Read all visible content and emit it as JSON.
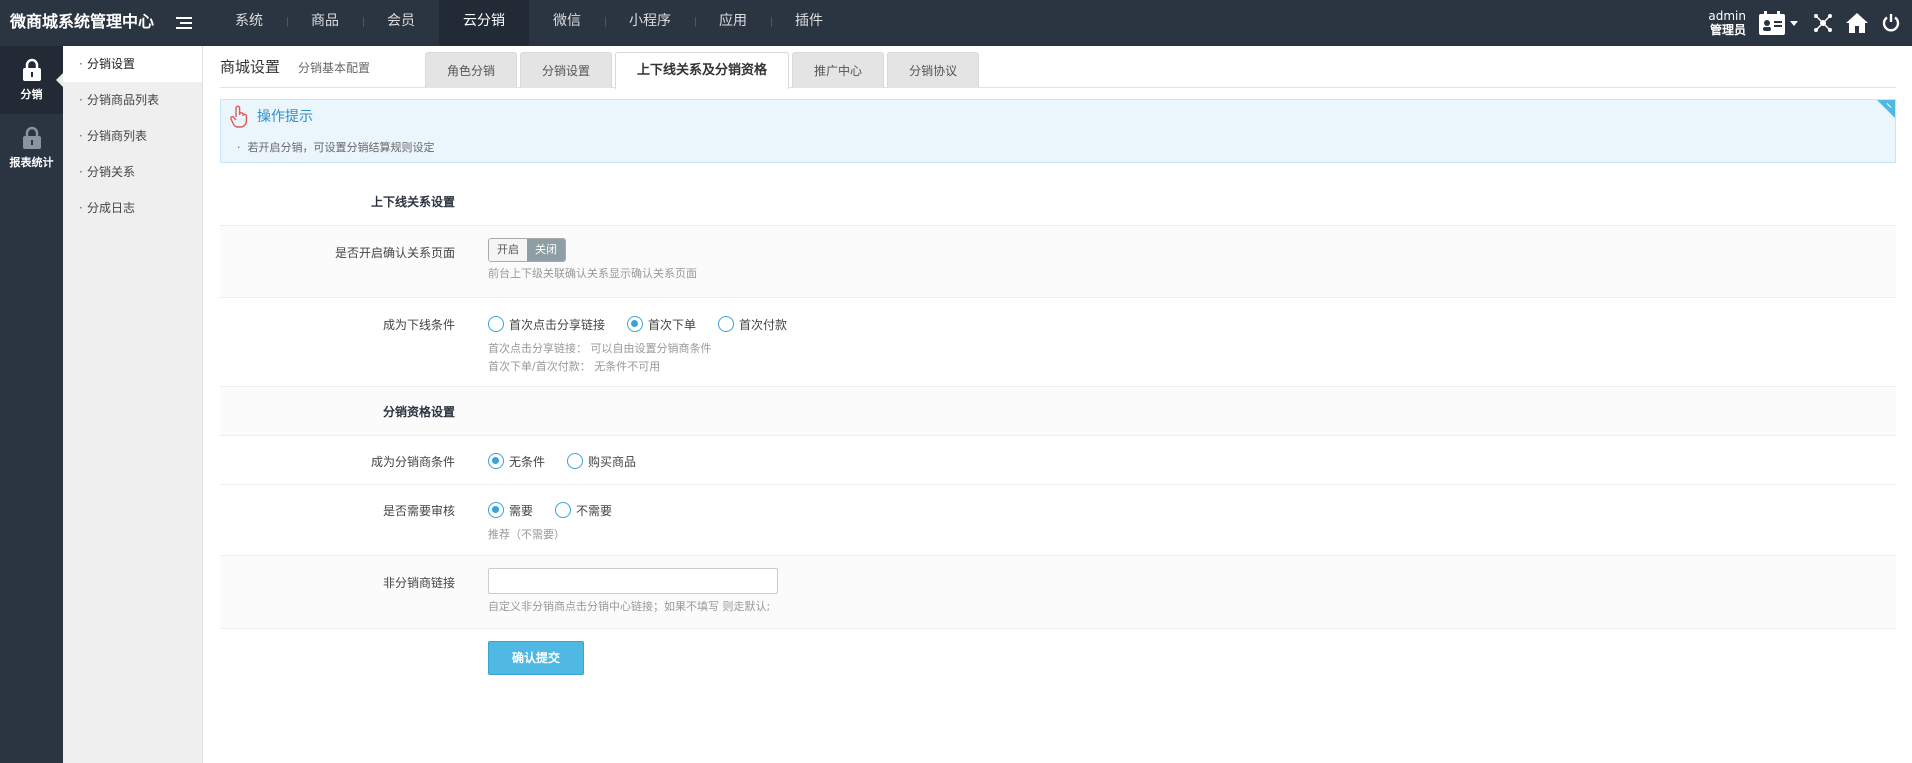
{
  "app": {
    "title": "微商城系统管理中心"
  },
  "nav": [
    "系统",
    "商品",
    "会员",
    "云分销",
    "微信",
    "小程序",
    "应用",
    "插件"
  ],
  "user": {
    "name": "admin",
    "role": "管理员"
  },
  "iconbar": [
    {
      "label": "分销",
      "icon": "lock-icon"
    },
    {
      "label": "报表统计",
      "icon": "lock-icon"
    }
  ],
  "submenu": [
    "分销设置",
    "分销商品列表",
    "分销商列表",
    "分销关系",
    "分成日志"
  ],
  "page": {
    "title": "商城设置",
    "subtitle": "分销基本配置"
  },
  "tabs": [
    "角色分销",
    "分销设置",
    "上下线关系及分销资格",
    "推广中心",
    "分销协议"
  ],
  "tip": {
    "title": "操作提示",
    "text": "若开启分销，可设置分销结算规则设定"
  },
  "form": {
    "section1": "上下线关系设置",
    "confirm_page": {
      "label": "是否开启确认关系页面",
      "on": "开启",
      "off": "关闭",
      "help": "前台上下级关联确认关系显示确认关系页面"
    },
    "downline": {
      "label": "成为下线条件",
      "options": [
        "首次点击分享链接",
        "首次下单",
        "首次付款"
      ],
      "help1": "首次点击分享链接： 可以自由设置分销商条件",
      "help2": "首次下单/首次付款： 无条件不可用"
    },
    "section2": "分销资格设置",
    "become": {
      "label": "成为分销商条件",
      "options": [
        "无条件",
        "购买商品"
      ]
    },
    "audit": {
      "label": "是否需要审核",
      "options": [
        "需要",
        "不需要"
      ],
      "help": "推荐（不需要）"
    },
    "link": {
      "label": "非分销商链接",
      "value": "",
      "help": "自定义非分销商点击分销中心链接；如果不填写 则走默认;"
    },
    "submit": "确认提交"
  },
  "colors": {
    "topbar": "#2b3441",
    "accent": "#4fb8e3"
  }
}
